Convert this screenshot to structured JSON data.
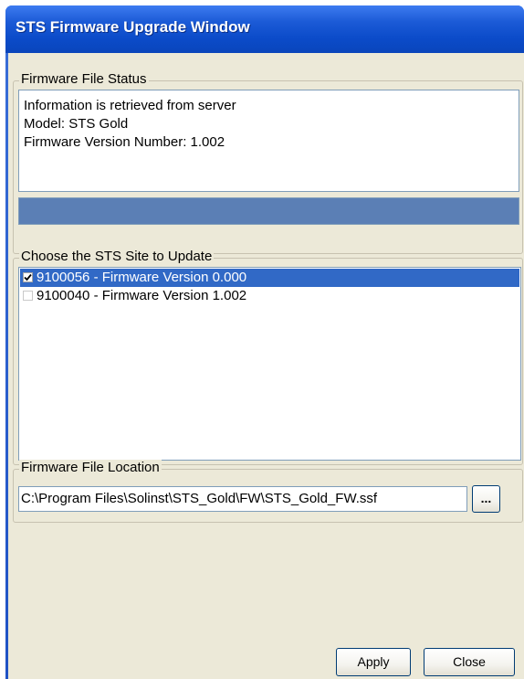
{
  "window": {
    "title": "STS Firmware Upgrade Window"
  },
  "status_group": {
    "legend": "Firmware File Status",
    "lines": [
      "Information is retrieved from server",
      "Model: STS Gold",
      "Firmware Version Number: 1.002"
    ],
    "progress_percent": 100
  },
  "site_group": {
    "legend": "Choose the STS Site to Update",
    "items": [
      {
        "label": "9100056 - Firmware Version 0.000",
        "checked": true,
        "selected": true
      },
      {
        "label": "9100040 - Firmware Version 1.002",
        "checked": false,
        "selected": false
      }
    ]
  },
  "location_group": {
    "legend": "Firmware File Location",
    "path": "C:\\Program Files\\Solinst\\STS_Gold\\FW\\STS_Gold_FW.ssf",
    "browse_label": "..."
  },
  "buttons": {
    "apply": "Apply",
    "close": "Close"
  },
  "colors": {
    "title_bar": "#0a4bc9",
    "selection": "#3169c6",
    "progress": "#5b7fb5",
    "face": "#ece9d8"
  }
}
